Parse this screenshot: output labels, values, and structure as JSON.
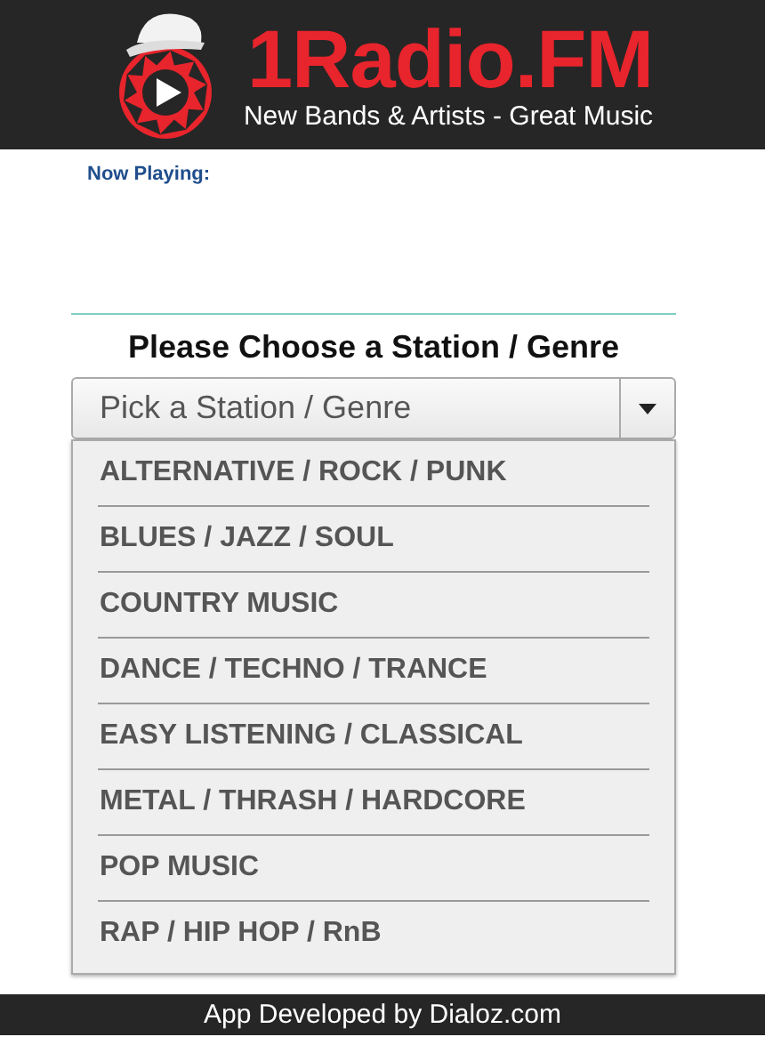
{
  "header": {
    "brand": "1Radio.FM",
    "tagline": "New Bands & Artists - Great Music"
  },
  "now_playing": {
    "label": "Now Playing:"
  },
  "station_picker": {
    "heading": "Please Choose a Station / Genre",
    "placeholder": "Pick a Station / Genre",
    "expanded": true,
    "options": [
      {
        "label": "ALTERNATIVE / ROCK / PUNK"
      },
      {
        "label": "BLUES / JAZZ / SOUL"
      },
      {
        "label": "COUNTRY MUSIC"
      },
      {
        "label": "DANCE / TECHNO / TRANCE"
      },
      {
        "label": "EASY LISTENING / CLASSICAL"
      },
      {
        "label": "METAL / THRASH / HARDCORE"
      },
      {
        "label": "POP MUSIC"
      },
      {
        "label": "RAP / HIP HOP / RnB"
      }
    ]
  },
  "footer": {
    "credit": "App Developed by Dialoz.com"
  }
}
